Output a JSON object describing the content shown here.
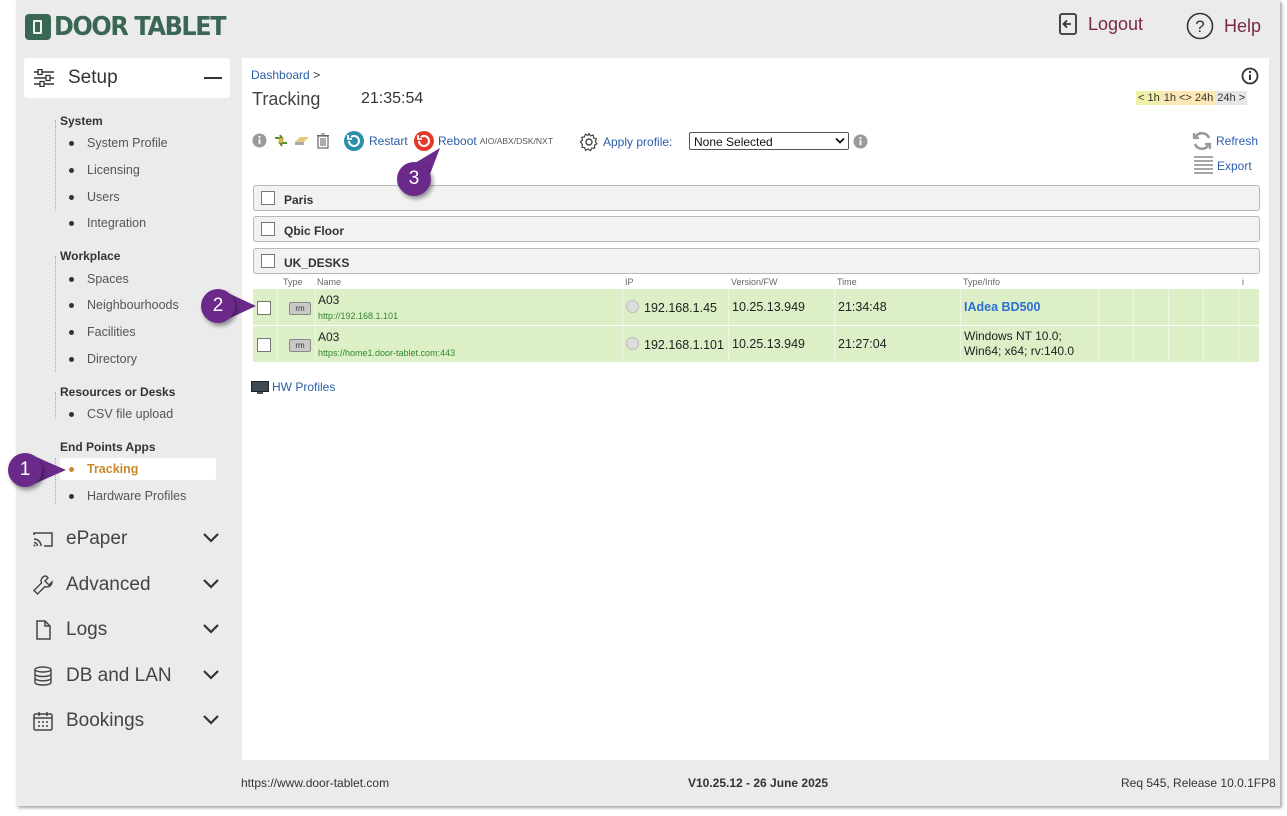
{
  "header": {
    "logo_text": "DOOR TABLET",
    "logout_label": "Logout",
    "help_label": "Help"
  },
  "sidebar": {
    "setup_label": "Setup",
    "groups": [
      {
        "title": "System",
        "items": [
          "System Profile",
          "Licensing",
          "Users",
          "Integration"
        ]
      },
      {
        "title": "Workplace",
        "items": [
          "Spaces",
          "Neighbourhoods",
          "Facilities",
          "Directory"
        ]
      },
      {
        "title": "Resources or Desks",
        "items": [
          "CSV file upload"
        ]
      },
      {
        "title": "End Points Apps",
        "items": [
          "Tracking",
          "Hardware Profiles"
        ]
      }
    ],
    "active_item": "Tracking",
    "collapsed": [
      "ePaper",
      "Advanced",
      "Logs",
      "DB and LAN",
      "Bookings"
    ]
  },
  "main": {
    "breadcrumb": "Dashboard",
    "breadcrumb_sep": ">",
    "title": "Tracking",
    "clock": "21:35:54",
    "time_filters": [
      "< 1h",
      "1h <> 24h",
      "24h >"
    ],
    "toolbar": {
      "restart_label": "Restart",
      "reboot_label": "Reboot",
      "reboot_note": "AIO/ABX/DSK/NXT",
      "apply_profile_label": "Apply profile:",
      "profile_selected": "None Selected",
      "refresh_label": "Refresh",
      "export_label": "Export"
    },
    "groups": [
      "Paris",
      "Qbic Floor",
      "UK_DESKS"
    ],
    "columns": [
      "Type",
      "Name",
      "IP",
      "Version/FW",
      "Time",
      "Type/Info",
      "i"
    ],
    "rows": [
      {
        "type": "rm",
        "name": "A03",
        "url": "http://192.168.1.101",
        "ip": "192.168.1.45",
        "version": "10.25.13.949",
        "time": "21:34:48",
        "info": "IAdea BD500",
        "info2": ""
      },
      {
        "type": "rm",
        "name": "A03",
        "url": "https://home1.door-tablet.com:443",
        "ip": "192.168.1.101",
        "version": "10.25.13.949",
        "time": "21:27:04",
        "info": "Windows NT 10.0;",
        "info2": "Win64; x64; rv:140.0"
      }
    ],
    "hw_profiles_label": "HW Profiles"
  },
  "callouts": [
    "1",
    "2",
    "3"
  ],
  "footer": {
    "url": "https://www.door-tablet.com",
    "version": "V10.25.12 - 26 June 2025",
    "release": "Req 545, Release 10.0.1FP8"
  }
}
